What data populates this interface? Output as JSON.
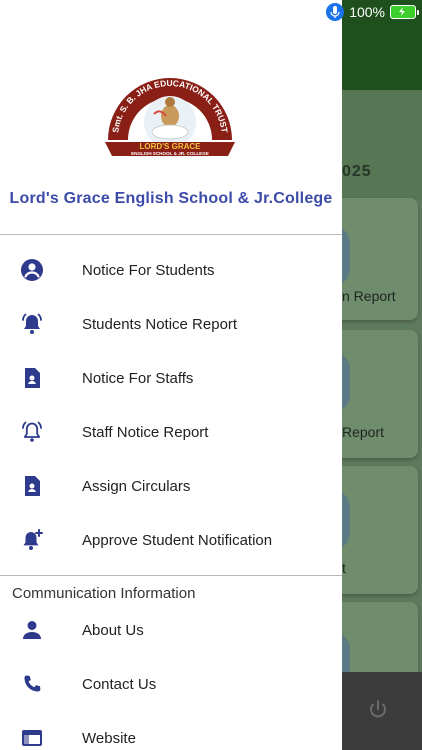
{
  "status_bar": {
    "battery_percent": "100%"
  },
  "background": {
    "year_fragment": "025",
    "cards": [
      {
        "label": "n Report"
      },
      {
        "label": "Report"
      },
      {
        "label": "t"
      },
      {
        "label": ""
      }
    ]
  },
  "drawer": {
    "school_name": "Lord's Grace English School & Jr.College",
    "logo_text": {
      "top": "Smt. S. B. JHA EDUCATIONAL TRUST",
      "banner": "LORD'S GRACE",
      "sub": "ENGLISH SCHOOL & JR. COLLEGE"
    },
    "menu_items": [
      {
        "label": "Notice For Students",
        "icon": "account-circle-icon"
      },
      {
        "label": "Students Notice Report",
        "icon": "bell-ring-icon"
      },
      {
        "label": "Notice For Staffs",
        "icon": "document-person-icon"
      },
      {
        "label": "Staff Notice Report",
        "icon": "bell-ring-outline-icon"
      },
      {
        "label": "Assign Circulars",
        "icon": "document-person-icon"
      },
      {
        "label": "Approve Student Notification",
        "icon": "bell-plus-icon"
      }
    ],
    "section_title": "Communication Information",
    "info_items": [
      {
        "label": "About Us",
        "icon": "person-icon"
      },
      {
        "label": "Contact Us",
        "icon": "phone-icon"
      },
      {
        "label": "Website",
        "icon": "web-window-icon"
      }
    ]
  },
  "colors": {
    "accent": "#3c4aa8",
    "icon": "#2e3a8c",
    "header_green": "#1f4f1c"
  }
}
